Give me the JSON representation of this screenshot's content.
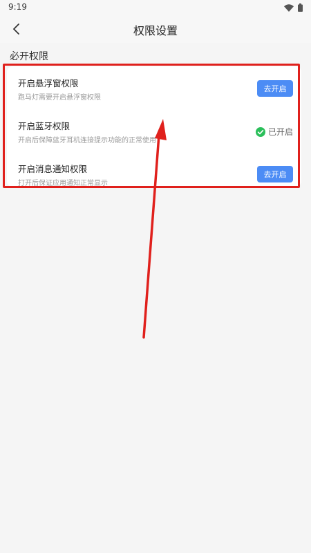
{
  "status_bar": {
    "time": "9:19"
  },
  "header": {
    "title": "权限设置",
    "back_icon": "chevron-left-icon"
  },
  "section": {
    "title": "必开权限"
  },
  "permissions": [
    {
      "title": "开启悬浮窗权限",
      "desc": "跑马灯需要开启悬浮窗权限",
      "action_label": "去开启"
    },
    {
      "title": "开启蓝牙权限",
      "desc": "开启后保障蓝牙耳机连接提示功能的正常使用",
      "status_label": "已开启"
    },
    {
      "title": "开启消息通知权限",
      "desc": "打开后保证应用通知正常显示",
      "action_label": "去开启"
    }
  ],
  "colors": {
    "accent": "#4c8cf5",
    "success": "#2bbf5a",
    "annotation": "#e0201c"
  }
}
